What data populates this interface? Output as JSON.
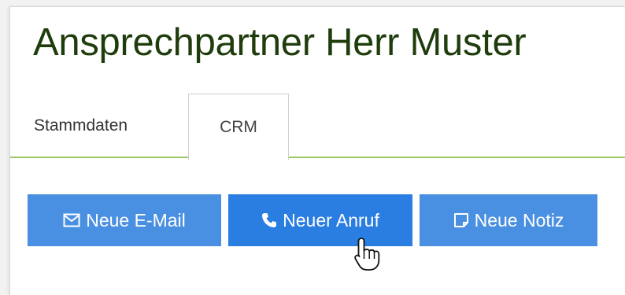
{
  "page": {
    "title": "Ansprechpartner Herr Muster"
  },
  "tabs": [
    {
      "label": "Stammdaten",
      "active": false
    },
    {
      "label": "CRM",
      "active": true
    }
  ],
  "actions": {
    "email_label": "Neue E-Mail",
    "email_icon": "envelope-icon",
    "call_label": "Neuer Anruf",
    "call_icon": "phone-icon",
    "note_label": "Neue Notiz",
    "note_icon": "note-icon"
  },
  "colors": {
    "title": "#1f3d0c",
    "tab_underline": "#9fc76a",
    "button": "#4a90e2",
    "button_hover": "#2a7de1"
  }
}
